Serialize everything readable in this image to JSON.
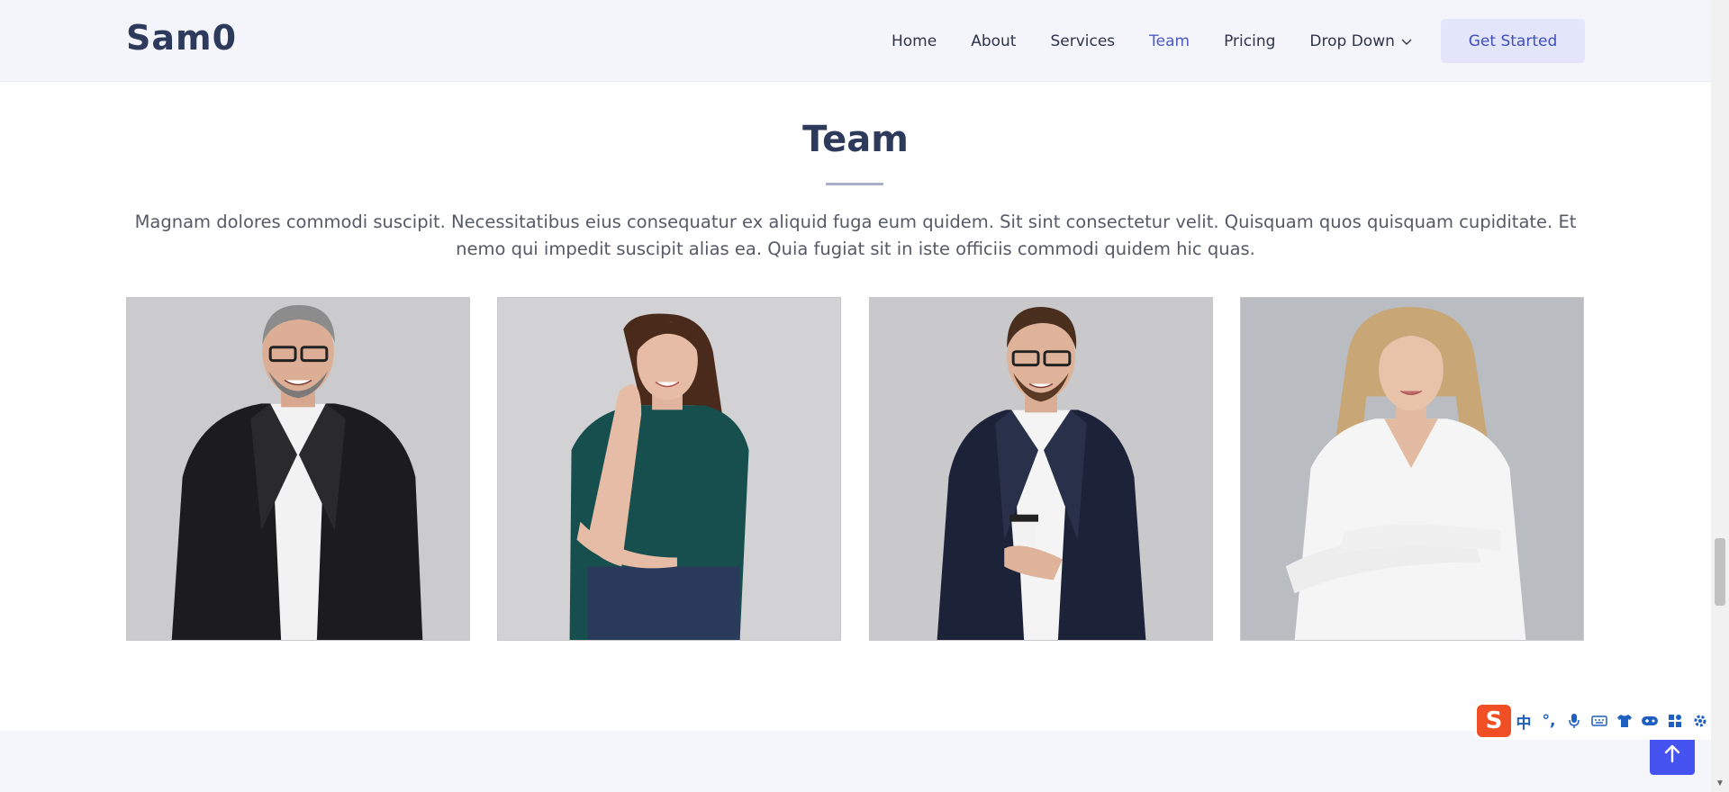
{
  "header": {
    "logo": "Sam0",
    "nav": [
      {
        "label": "Home",
        "active": false
      },
      {
        "label": "About",
        "active": false
      },
      {
        "label": "Services",
        "active": false
      },
      {
        "label": "Team",
        "active": true
      },
      {
        "label": "Pricing",
        "active": false
      },
      {
        "label": "Drop Down",
        "active": false,
        "has_dropdown": true
      }
    ],
    "cta_label": "Get Started"
  },
  "team": {
    "title": "Team",
    "description": "Magnam dolores commodi suscipit. Necessitatibus eius consequatur ex aliquid fuga eum quidem. Sit sint consectetur velit. Quisquam quos quisquam cupiditate. Et nemo qui impedit suscipit alias ea. Quia fugiat sit in iste officiis commodi quidem hic quas.",
    "members": [
      {
        "photo": "man-gray-hair-glasses-black-blazer"
      },
      {
        "photo": "woman-long-brown-hair-green-top"
      },
      {
        "photo": "man-glasses-navy-blazer-coffee-cup"
      },
      {
        "photo": "woman-blonde-white-blouse-arms-crossed"
      }
    ]
  },
  "ime_toolbar": {
    "logo": "S",
    "items": [
      "中",
      "°,",
      "mic-icon",
      "keyboard-icon",
      "shirt-icon",
      "game-icon",
      "apps-icon",
      "settings-icon"
    ]
  },
  "colors": {
    "accent": "#4c59c8",
    "heading": "#2d3a5b",
    "header_bg": "#f4f5fb",
    "cta_bg": "#e3e6fb",
    "back_to_top": "#4553f0",
    "ime_brand": "#f04f25"
  }
}
